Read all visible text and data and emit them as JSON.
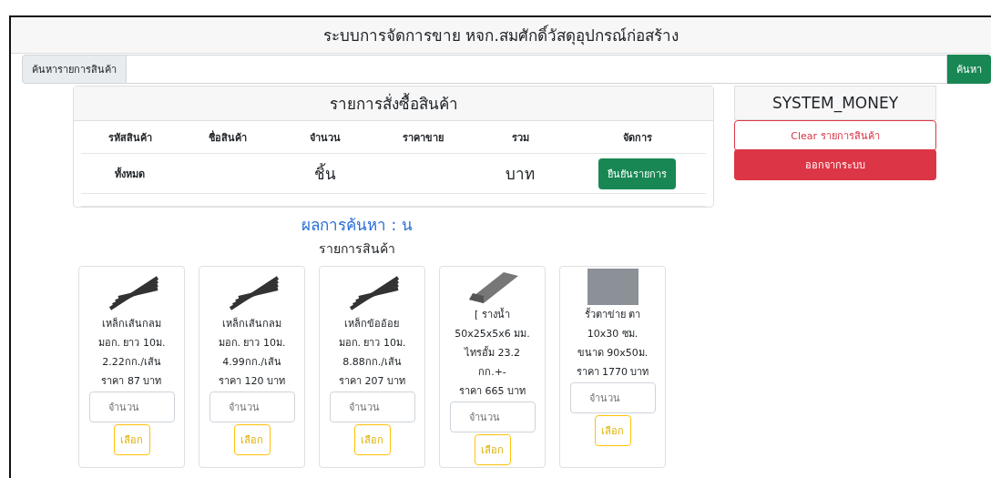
{
  "header": {
    "title": "ระบบการจัดการขาย หจก.สมศักดิ์วัสดุอุปกรณ์ก่อสร้าง"
  },
  "search": {
    "label": "ค้นหารายการสินค้า",
    "button": "ค้นหา"
  },
  "order": {
    "title": "รายการสั่งซื้อสินค้า",
    "columns": [
      "รหัสสินค้า",
      "ชื่อสินค้า",
      "จำนวน",
      "ราคาขาย",
      "รวม",
      "จัดการ"
    ],
    "total_row": {
      "label": "ทั้งหมด",
      "quantity_unit": "ชิ้น",
      "sum_unit": "บาท",
      "confirm_button": "ยืนยันรายการ"
    }
  },
  "side": {
    "title": "SYSTEM_MONEY",
    "clear_button": "Clear รายการสินค้า",
    "logout_button": "ออกจากระบบ"
  },
  "results": {
    "heading": "ผลการค้นหา : น",
    "subheading": "รายการสินค้า",
    "products": [
      {
        "kind": "rebar",
        "lines": [
          "เหล็กเส้นกลม",
          "มอก. ยาว 10ม.",
          "2.22กก./เส้น",
          "ราคา 87 บาท"
        ],
        "placeholder": "จำนวน",
        "button": "เลือก"
      },
      {
        "kind": "rebar",
        "lines": [
          "เหล็กเส้นกลม",
          "มอก. ยาว 10ม.",
          "4.99กก./เส้น",
          "ราคา 120 บาท"
        ],
        "placeholder": "จำนวน",
        "button": "เลือก"
      },
      {
        "kind": "rebar",
        "lines": [
          "เหล็กข้ออ้อย",
          "มอก. ยาว 10ม.",
          "8.88กก./เส้น",
          "ราคา 207 บาท"
        ],
        "placeholder": "จำนวน",
        "button": "เลือก"
      },
      {
        "kind": "channel",
        "lines": [
          "[ รางน้ำ",
          "50x25x5x6 มม.",
          "ไทรอั้ม 23.2",
          "กก.+-",
          "ราคา 665 บาท"
        ],
        "placeholder": "จำนวน",
        "button": "เลือก"
      },
      {
        "kind": "mesh",
        "lines": [
          "รั้วตาข่าย ตา",
          "10x30 ซม.",
          "ขนาด 90x50ม.",
          "ราคา 1770 บาท"
        ],
        "placeholder": "จำนวน",
        "button": "เลือก"
      }
    ]
  }
}
